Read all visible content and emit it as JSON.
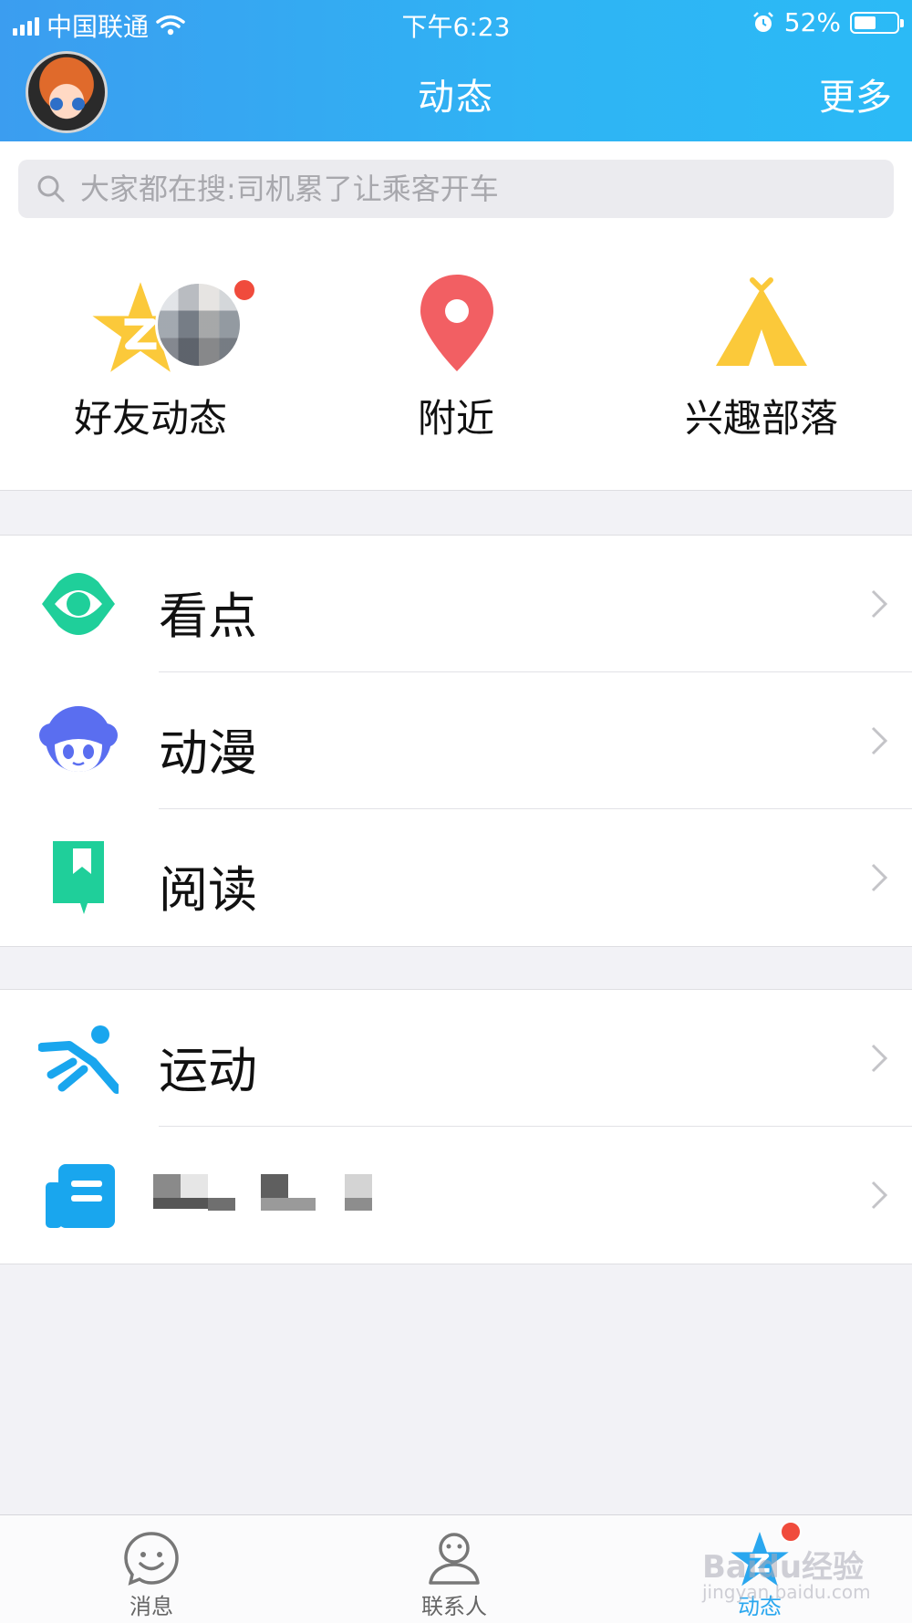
{
  "status_bar": {
    "carrier": "中国联通",
    "time": "下午6:23",
    "battery": "52%",
    "battery_level": 0.52
  },
  "header": {
    "title": "动态",
    "more_label": "更多"
  },
  "search": {
    "placeholder": "大家都在搜:司机累了让乘客开车"
  },
  "shortcuts": [
    {
      "label": "好友动态",
      "icon": "star-icon"
    },
    {
      "label": "附近",
      "icon": "location-pin-icon"
    },
    {
      "label": "兴趣部落",
      "icon": "tent-icon"
    }
  ],
  "sections": [
    {
      "items": [
        {
          "label": "看点",
          "icon": "eye-icon",
          "color": "#1fcf9a"
        },
        {
          "label": "动漫",
          "icon": "anime-face-icon",
          "color": "#5a6ef0"
        },
        {
          "label": "阅读",
          "icon": "book-icon",
          "color": "#1fcf9a"
        }
      ]
    },
    {
      "items": [
        {
          "label": "运动",
          "icon": "running-icon",
          "color": "#19a6ee"
        },
        {
          "label": "",
          "icon": "news-icon",
          "color": "#19a6ee"
        }
      ]
    }
  ],
  "tabs": [
    {
      "label": "消息",
      "icon": "smiley-chat-icon",
      "active": false
    },
    {
      "label": "联系人",
      "icon": "person-icon",
      "active": false
    },
    {
      "label": "动态",
      "icon": "star-icon",
      "active": true
    }
  ],
  "watermark": {
    "brand": "Baidu经验",
    "url": "jingyan.baidu.com"
  }
}
